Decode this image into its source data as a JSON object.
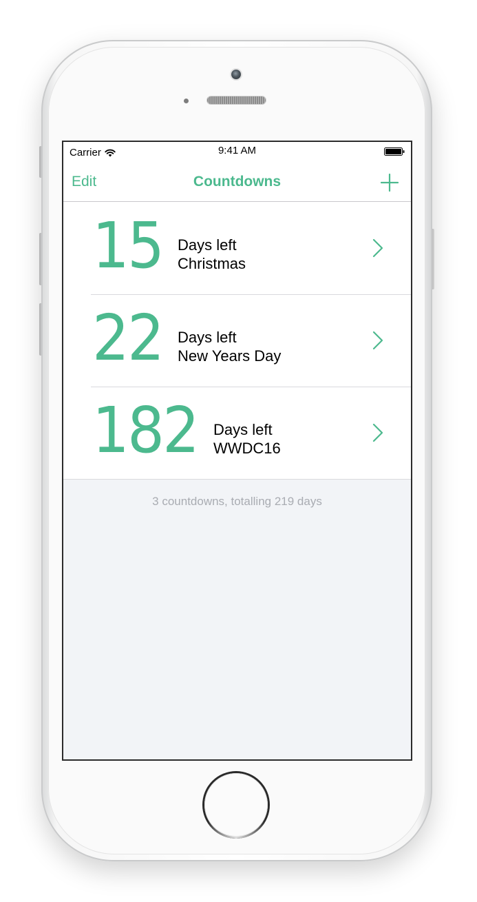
{
  "status_bar": {
    "carrier": "Carrier",
    "time": "9:41 AM"
  },
  "nav": {
    "edit_label": "Edit",
    "title": "Countdowns",
    "add_icon": "plus-icon"
  },
  "countdowns": [
    {
      "days": "15",
      "label": "Days left",
      "event": "Christmas"
    },
    {
      "days": "22",
      "label": "Days left",
      "event": "New Years Day"
    },
    {
      "days": "182",
      "label": "Days left",
      "event": "WWDC16"
    }
  ],
  "footer": {
    "summary": "3 countdowns, totalling 219 days"
  },
  "colors": {
    "accent": "#4cb98e",
    "background": "#f2f4f7",
    "footer_text": "#a9acb2"
  }
}
